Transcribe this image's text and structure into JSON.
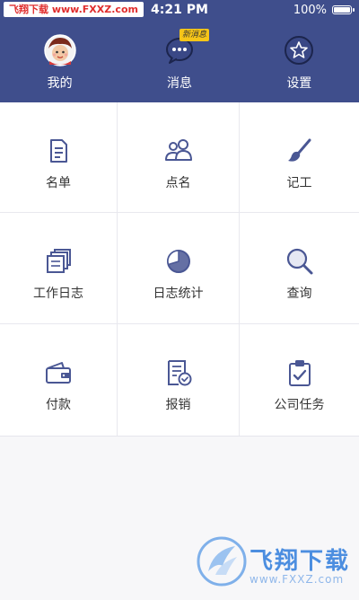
{
  "status_bar": {
    "watermark_text": "飞翔下载 www.FXXZ.com",
    "time": "4:21 PM",
    "battery": "100%"
  },
  "top_tabs": [
    {
      "label": "我的",
      "icon": "avatar"
    },
    {
      "label": "消息",
      "icon": "chat-bubble-icon",
      "badge": "新消息"
    },
    {
      "label": "设置",
      "icon": "star-settings-icon"
    }
  ],
  "grid": [
    {
      "label": "名单",
      "icon": "document-list-icon"
    },
    {
      "label": "点名",
      "icon": "people-group-icon"
    },
    {
      "label": "记工",
      "icon": "paintbrush-icon"
    },
    {
      "label": "工作日志",
      "icon": "stacked-papers-icon"
    },
    {
      "label": "日志统计",
      "icon": "pie-chart-icon"
    },
    {
      "label": "查询",
      "icon": "magnifier-icon"
    },
    {
      "label": "付款",
      "icon": "wallet-icon"
    },
    {
      "label": "报销",
      "icon": "receipt-check-icon"
    },
    {
      "label": "公司任务",
      "icon": "clipboard-check-icon"
    }
  ],
  "watermark_bottom": {
    "brand": "飞翔下载",
    "url": "www.FXXZ.com"
  },
  "colors": {
    "header_bg": "#3f4e8c",
    "icon_accent": "#4a5794",
    "badge": "#f6c518"
  }
}
